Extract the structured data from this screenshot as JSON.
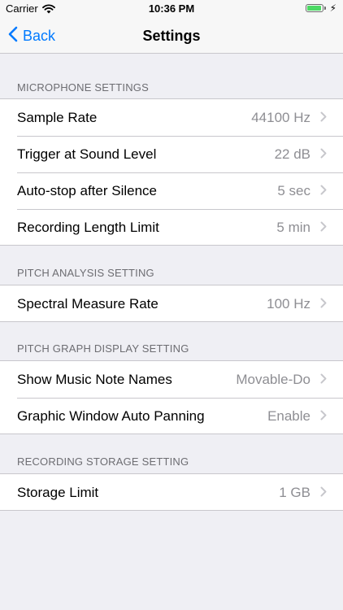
{
  "status_bar": {
    "carrier": "Carrier",
    "time": "10:36 PM",
    "battery_level": 0.95
  },
  "nav": {
    "back_label": "Back",
    "title": "Settings"
  },
  "sections": [
    {
      "header": "MICROPHONE SETTINGS",
      "rows": [
        {
          "label": "Sample Rate",
          "value": "44100 Hz"
        },
        {
          "label": "Trigger at Sound Level",
          "value": "22 dB"
        },
        {
          "label": "Auto-stop after Silence",
          "value": "5 sec"
        },
        {
          "label": "Recording Length Limit",
          "value": "5 min"
        }
      ]
    },
    {
      "header": "PITCH ANALYSIS SETTING",
      "rows": [
        {
          "label": "Spectral Measure Rate",
          "value": "100 Hz"
        }
      ]
    },
    {
      "header": "PITCH GRAPH DISPLAY SETTING",
      "rows": [
        {
          "label": "Show Music Note Names",
          "value": "Movable-Do"
        },
        {
          "label": "Graphic Window Auto Panning",
          "value": "Enable"
        }
      ]
    },
    {
      "header": "RECORDING STORAGE SETTING",
      "rows": [
        {
          "label": "Storage Limit",
          "value": "1 GB"
        }
      ]
    }
  ],
  "colors": {
    "accent": "#007aff",
    "background": "#efeff4",
    "value_text": "#8e8e93",
    "battery": "#4cd964"
  }
}
